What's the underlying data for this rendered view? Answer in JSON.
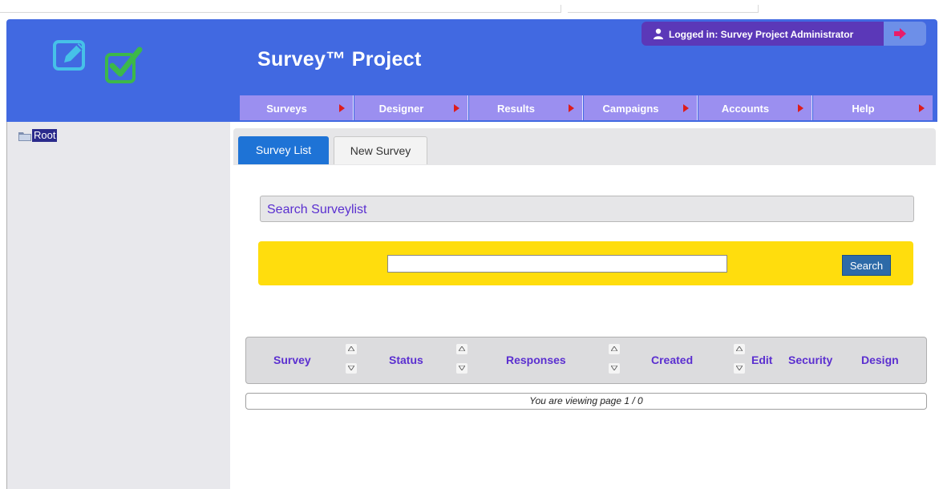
{
  "app": {
    "title": "Survey™ Project",
    "logged_in_text": "Logged in: Survey Project Administrator"
  },
  "icons": {
    "logo_edit": "edit-icon",
    "logo_check": "checkbox-checked-icon",
    "user": "user-icon",
    "logout": "sign-out-icon",
    "folder": "folder-icon",
    "sort_up": "sort-up-icon",
    "sort_down": "sort-down-icon"
  },
  "colors": {
    "header_bg": "#4169e1",
    "nav_bg": "#9b8ff0",
    "nav_arrow": "#dd1c1c",
    "accent_purple": "#5b2fd0",
    "active_tab": "#1e73d6",
    "search_panel": "#ffdd0d",
    "search_button": "#2d6aa8"
  },
  "nav": {
    "items": [
      {
        "label": "Surveys"
      },
      {
        "label": "Designer"
      },
      {
        "label": "Results"
      },
      {
        "label": "Campaigns"
      },
      {
        "label": "Accounts"
      },
      {
        "label": "Help"
      }
    ]
  },
  "tree": {
    "root_label": "Root"
  },
  "tabs": {
    "survey_list": "Survey List",
    "new_survey": "New Survey"
  },
  "search": {
    "header": "Search Surveylist",
    "input_value": "",
    "button_label": "Search"
  },
  "table": {
    "columns": [
      "Survey",
      "Status",
      "Responses",
      "Created",
      "Edit",
      "Security",
      "Design"
    ]
  },
  "pager": {
    "text": "You are viewing page 1 / 0"
  }
}
